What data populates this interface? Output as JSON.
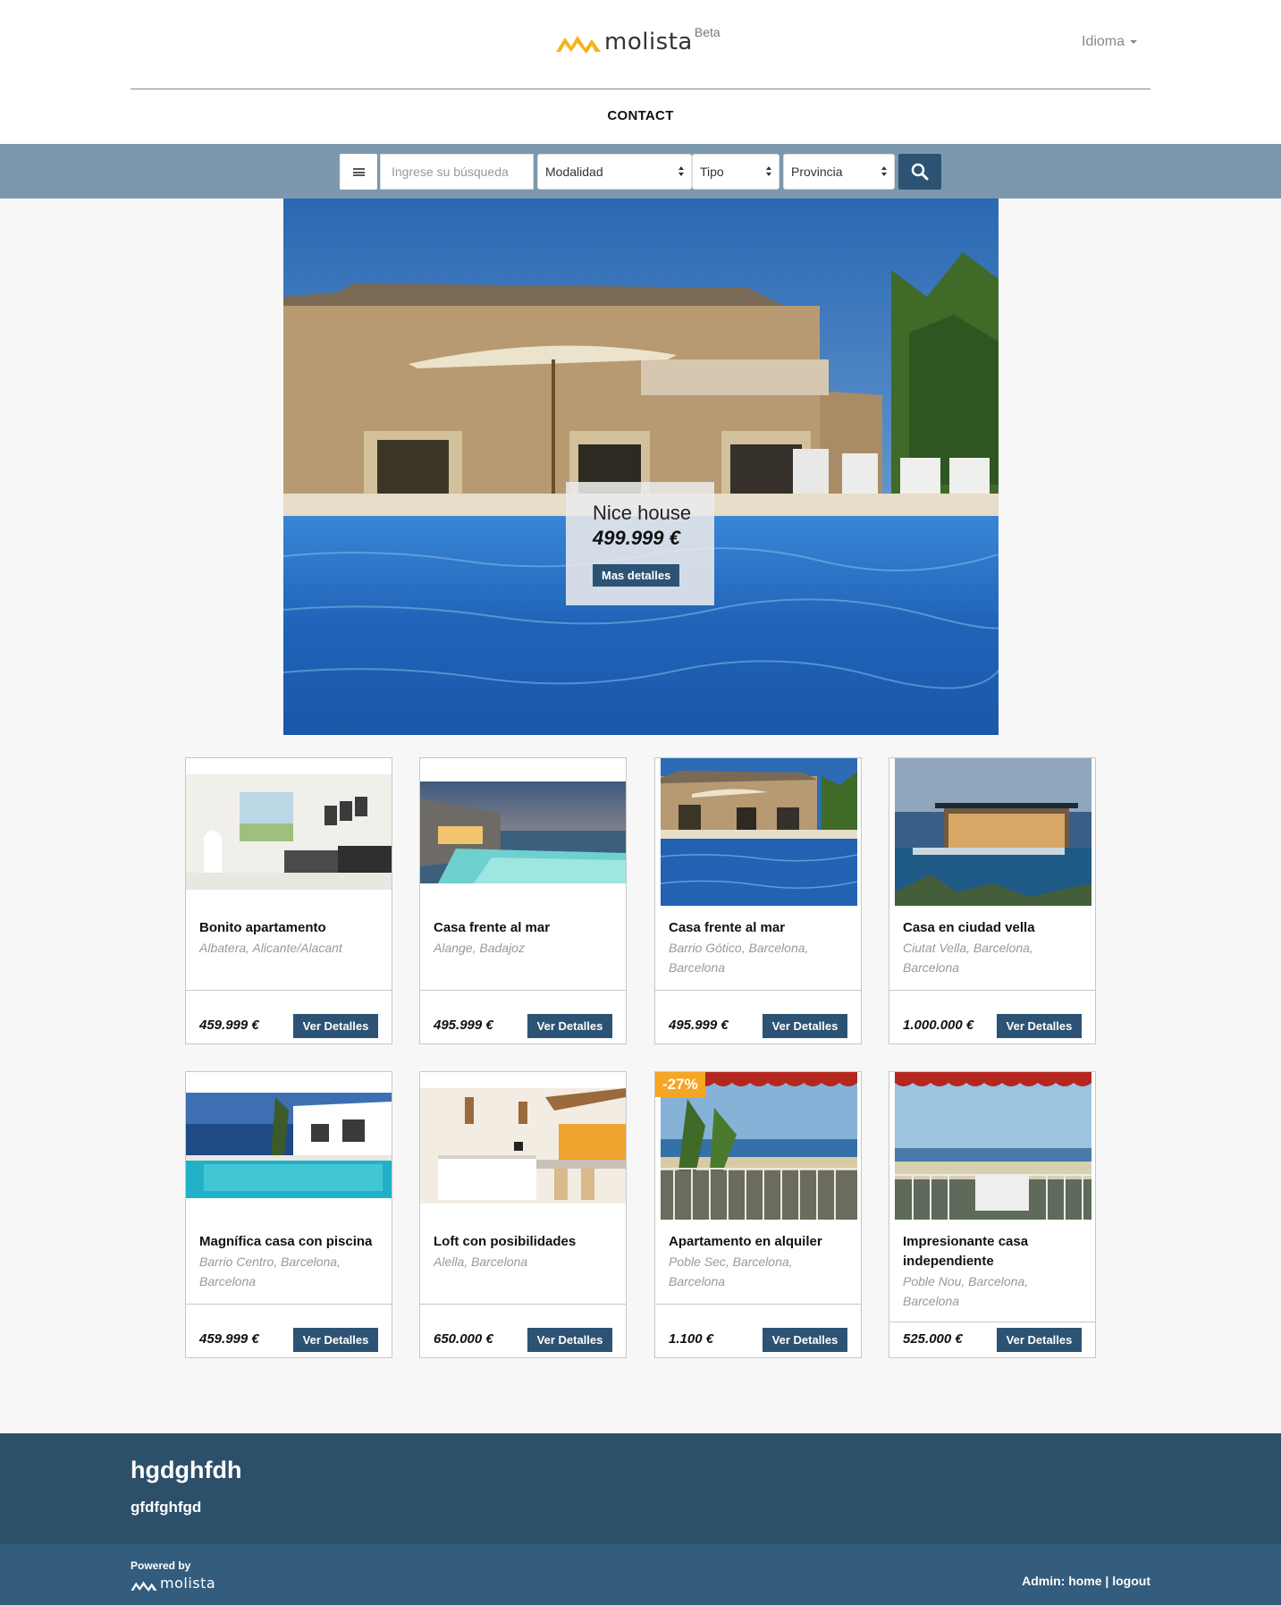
{
  "header": {
    "logo_text": "molista",
    "logo_beta": "Beta",
    "language_label": "Idioma",
    "nav_contact": "CONTACT"
  },
  "search": {
    "placeholder": "Ingrese su búsqueda",
    "modality": "Modalidad",
    "type": "Tipo",
    "province": "Provincia"
  },
  "hero": {
    "title": "Nice house",
    "price": "499.999 €",
    "button": "Mas detalles"
  },
  "listings": [
    {
      "title": "Bonito apartamento",
      "location": "Albatera, Alicante/Alacant",
      "price": "459.999 €",
      "button": "Ver Detalles"
    },
    {
      "title": "Casa frente al mar",
      "location": "Alange, Badajoz",
      "price": "495.999 €",
      "button": "Ver Detalles"
    },
    {
      "title": "Casa frente al mar",
      "location": "Barrio Gótico, Barcelona, Barcelona",
      "price": "495.999 €",
      "button": "Ver Detalles"
    },
    {
      "title": "Casa en ciudad vella",
      "location": "Ciutat Vella, Barcelona, Barcelona",
      "price": "1.000.000 €",
      "button": "Ver Detalles"
    },
    {
      "title": "Magnífica casa con piscina",
      "location": "Barrio Centro, Barcelona, Barcelona",
      "price": "459.999 €",
      "button": "Ver Detalles"
    },
    {
      "title": "Loft con posibilidades",
      "location": "Alella, Barcelona",
      "price": "650.000 €",
      "button": "Ver Detalles"
    },
    {
      "title": "Apartamento en alquiler",
      "location": "Poble Sec, Barcelona, Barcelona",
      "price": "1.100 €",
      "button": "Ver Detalles",
      "badge": "-27%"
    },
    {
      "title": "Impresionante casa independiente",
      "location": "Poble Nou, Barcelona, Barcelona",
      "price": "525.000 €",
      "button": "Ver Detalles"
    }
  ],
  "footer": {
    "title": "hgdghfdh",
    "subtitle": "gfdfghfgd",
    "powered_by": "Powered by",
    "logo_text": "molista",
    "admin_label": "Admin:",
    "home_link": "home",
    "separator": "|",
    "logout_link": "logout"
  },
  "colors": {
    "accent": "#2c5374",
    "search_bar": "#7c98ad",
    "footer_top": "#2c4f6a",
    "footer_bottom": "#335c7d",
    "logo_yellow": "#f5b316",
    "badge": "#f5a623"
  }
}
